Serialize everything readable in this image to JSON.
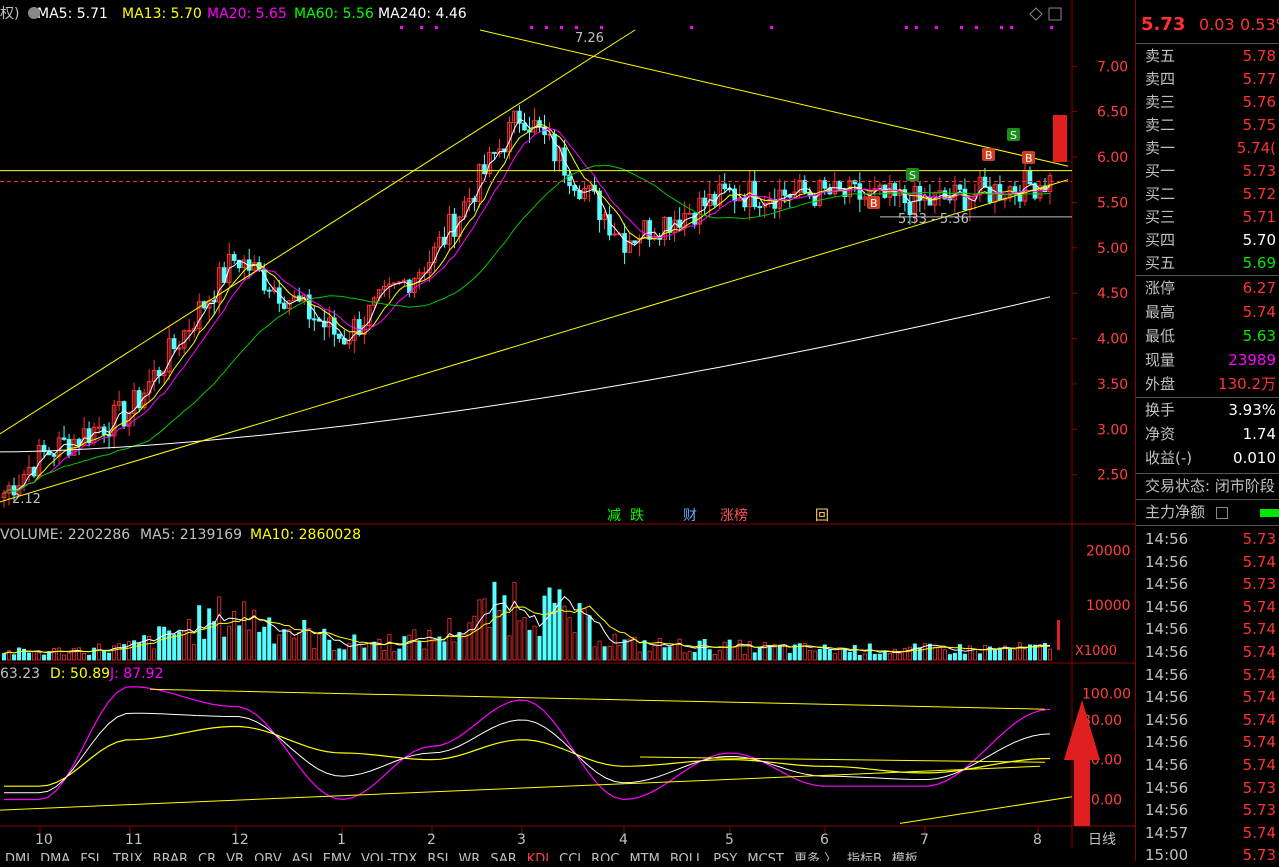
{
  "header": {
    "prefix": "权)",
    "ma": [
      {
        "label": "MA5: 5.71",
        "color": "#ffffff"
      },
      {
        "label": "MA13: 5.70",
        "color": "#ffff00"
      },
      {
        "label": "MA20: 5.65",
        "color": "#ff00ff"
      },
      {
        "label": "MA60: 5.56",
        "color": "#00ff00"
      },
      {
        "label": "MA240: 4.46",
        "color": "#ffffff"
      }
    ]
  },
  "annotations": {
    "high": "7.26",
    "low": "2.12",
    "range": "5.33 - 5.36",
    "signals": [
      {
        "text": "减",
        "color": "#00ff00"
      },
      {
        "text": "跌",
        "color": "#00ff00"
      },
      {
        "text": "财",
        "color": "#66aaff"
      },
      {
        "text": "涨榜",
        "color": "#ff5555"
      },
      {
        "text": "回",
        "color": "#ffcc66"
      }
    ],
    "bs_marks": [
      {
        "text": "S",
        "color": "#1a8f1a"
      },
      {
        "text": "B",
        "color": "#d04020"
      },
      {
        "text": "S",
        "color": "#1a8f1a"
      },
      {
        "text": "B",
        "color": "#d04020"
      },
      {
        "text": "B",
        "color": "#d04020"
      }
    ]
  },
  "volume_header": {
    "volume": "VOLUME: 2202286",
    "ma5": "MA5: 2139169",
    "ma10": "MA10: 2860028"
  },
  "kdj_header": {
    "k": "63.23",
    "d": "D: 50.89",
    "j": "J: 87.92"
  },
  "axis": {
    "price_ticks": [
      "7.00",
      "6.50",
      "6.00",
      "5.50",
      "5.00",
      "4.50",
      "4.00",
      "3.50",
      "3.00",
      "2.50"
    ],
    "volume_ticks": [
      "20000",
      "10000"
    ],
    "volume_unit": "X1000",
    "kdj_ticks": [
      "100.00",
      "80.00",
      "50.00",
      "20.00"
    ],
    "months": [
      "10",
      "11",
      "12",
      "1",
      "2",
      "3",
      "4",
      "5",
      "6",
      "7",
      "8"
    ],
    "period": "日线"
  },
  "chart_data": [
    {
      "type": "candlestick",
      "ylim": [
        2.0,
        7.4
      ],
      "x": [
        "10",
        "11",
        "12",
        "1",
        "2",
        "3",
        "4",
        "5",
        "6",
        "7",
        "8"
      ],
      "close_approx": [
        2.7,
        3.2,
        4.9,
        4.0,
        4.9,
        6.5,
        5.1,
        5.6,
        5.6,
        5.5,
        5.73
      ],
      "high": 7.26,
      "low": 2.12,
      "ma240_end": 4.46
    },
    {
      "type": "bar",
      "name": "VOLUME",
      "ylim": [
        0,
        21000
      ],
      "x": [
        "10",
        "11",
        "12",
        "1",
        "2",
        "3",
        "4",
        "5",
        "6",
        "7",
        "8"
      ],
      "values_approx": [
        1500,
        2500,
        9000,
        3000,
        4000,
        12000,
        3000,
        2500,
        2000,
        2000,
        2200
      ]
    },
    {
      "type": "line",
      "name": "KDJ",
      "ylim": [
        0,
        110
      ],
      "x": [
        "10",
        "11",
        "12",
        "1",
        "2",
        "3",
        "4",
        "5",
        "6",
        "7",
        "8"
      ],
      "series": [
        {
          "name": "D",
          "values": [
            30,
            65,
            75,
            55,
            50,
            65,
            45,
            50,
            45,
            40,
            50.89
          ]
        },
        {
          "name": "J",
          "values": [
            20,
            105,
            90,
            20,
            60,
            95,
            20,
            55,
            30,
            30,
            87.92
          ]
        }
      ]
    }
  ],
  "sidebar": {
    "title_price": "5.73",
    "title_change": "0.03",
    "title_pct": "0.53%",
    "book": [
      {
        "label": "卖五",
        "price": "5.78",
        "cls": "red"
      },
      {
        "label": "卖四",
        "price": "5.77",
        "cls": "red"
      },
      {
        "label": "卖三",
        "price": "5.76",
        "cls": "red"
      },
      {
        "label": "卖二",
        "price": "5.75",
        "cls": "red"
      },
      {
        "label": "卖一",
        "price": "5.74(",
        "cls": "red"
      },
      {
        "label": "买一",
        "price": "5.73",
        "cls": "red"
      },
      {
        "label": "买二",
        "price": "5.72",
        "cls": "red"
      },
      {
        "label": "买三",
        "price": "5.71",
        "cls": "red"
      },
      {
        "label": "买四",
        "price": "5.70",
        "cls": "white"
      },
      {
        "label": "买五",
        "price": "5.69",
        "cls": "green"
      }
    ],
    "stats": [
      {
        "label": "涨停",
        "value": "6.27",
        "cls": "red"
      },
      {
        "label": "最高",
        "value": "5.74",
        "cls": "red"
      },
      {
        "label": "最低",
        "value": "5.63",
        "cls": "green"
      },
      {
        "label": "现量",
        "value": "23989",
        "cls": "purple"
      },
      {
        "label": "外盘",
        "value": "130.2万",
        "cls": "red"
      }
    ],
    "fin": [
      {
        "label": "换手",
        "value": "3.93%",
        "cls": "white"
      },
      {
        "label": "净资",
        "value": "1.74",
        "cls": "white"
      },
      {
        "label": "收益(-)",
        "value": "0.010",
        "cls": "white"
      }
    ],
    "status_label": "交易状态: 闭市阶段",
    "netflow_label": "主力净额",
    "ticks": [
      {
        "t": "14:56",
        "p": "5.73",
        "cls": "red"
      },
      {
        "t": "14:56",
        "p": "5.74",
        "cls": "red"
      },
      {
        "t": "14:56",
        "p": "5.73",
        "cls": "red"
      },
      {
        "t": "14:56",
        "p": "5.74",
        "cls": "red"
      },
      {
        "t": "14:56",
        "p": "5.74",
        "cls": "red"
      },
      {
        "t": "14:56",
        "p": "5.74",
        "cls": "red"
      },
      {
        "t": "14:56",
        "p": "5.74",
        "cls": "red"
      },
      {
        "t": "14:56",
        "p": "5.74",
        "cls": "red"
      },
      {
        "t": "14:56",
        "p": "5.74",
        "cls": "red"
      },
      {
        "t": "14:56",
        "p": "5.74",
        "cls": "red"
      },
      {
        "t": "14:56",
        "p": "5.74",
        "cls": "red"
      },
      {
        "t": "14:56",
        "p": "5.73",
        "cls": "red"
      },
      {
        "t": "14:56",
        "p": "5.73",
        "cls": "red"
      },
      {
        "t": "14:57",
        "p": "5.74",
        "cls": "red"
      },
      {
        "t": "15:00",
        "p": "5.73",
        "cls": "red"
      }
    ]
  },
  "bottom_tabs": [
    "DMI",
    "DMA",
    "FSL",
    "TRIX",
    "BRAR",
    "CR",
    "VR",
    "OBV",
    "ASI",
    "EMV",
    "VOL-TDX",
    "RSI",
    "WR",
    "SAR",
    "KDJ",
    "CCI",
    "ROC",
    "MTM",
    "BOLL",
    "PSY",
    "MCST",
    "更多 〉",
    "指标B",
    "模板"
  ]
}
